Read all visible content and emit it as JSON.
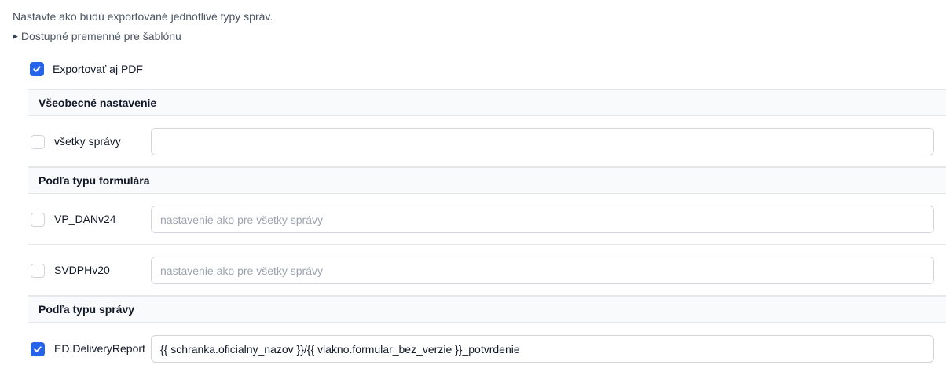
{
  "description": "Nastavte ako budú exportované jednotlivé typy správ.",
  "template_vars_toggle": "Dostupné premenné pre šablónu",
  "export_pdf": {
    "label": "Exportovať aj PDF",
    "checked": true
  },
  "sections": {
    "general": {
      "title": "Všeobecné nastavenie",
      "rows": [
        {
          "label": "všetky správy",
          "checked": false,
          "value": "",
          "placeholder": ""
        }
      ]
    },
    "by_form": {
      "title": "Podľa typu formulára",
      "rows": [
        {
          "label": "VP_DANv24",
          "checked": false,
          "value": "",
          "placeholder": "nastavenie ako pre všetky správy"
        },
        {
          "label": "SVDPHv20",
          "checked": false,
          "value": "",
          "placeholder": "nastavenie ako pre všetky správy"
        }
      ]
    },
    "by_message": {
      "title": "Podľa typu správy",
      "rows": [
        {
          "label": "ED.DeliveryReport",
          "checked": true,
          "value": "{{ schranka.oficialny_nazov }}/{{ vlakno.formular_bez_verzie }}_potvrdenie",
          "placeholder": ""
        }
      ]
    }
  },
  "colors": {
    "accent": "#2563eb",
    "section_bg": "#f9fafb",
    "border": "#e5e7eb",
    "muted_text": "#4b5563",
    "placeholder_text": "#9ca3af"
  },
  "icons": {
    "check": "check-icon",
    "triangle": "triangle-right-icon"
  }
}
